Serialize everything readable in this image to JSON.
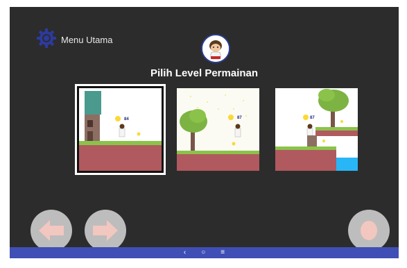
{
  "header": {
    "menu_label": "Menu Utama",
    "title": "Pilih Level Permainan"
  },
  "levels": [
    {
      "score": "84",
      "selected": true
    },
    {
      "score": "87",
      "selected": false
    },
    {
      "score": "87",
      "selected": false
    }
  ],
  "controls": {
    "left_icon": "arrow-left-icon",
    "right_icon": "arrow-right-icon",
    "action_icon": "circle-action-icon"
  },
  "system_nav": {
    "back": "‹",
    "home": "○",
    "recents": "≡"
  },
  "colors": {
    "background": "#2c2c2c",
    "accent": "#3f4fb5",
    "gear": "#2d3a9e",
    "button": "#bdbdbd"
  }
}
